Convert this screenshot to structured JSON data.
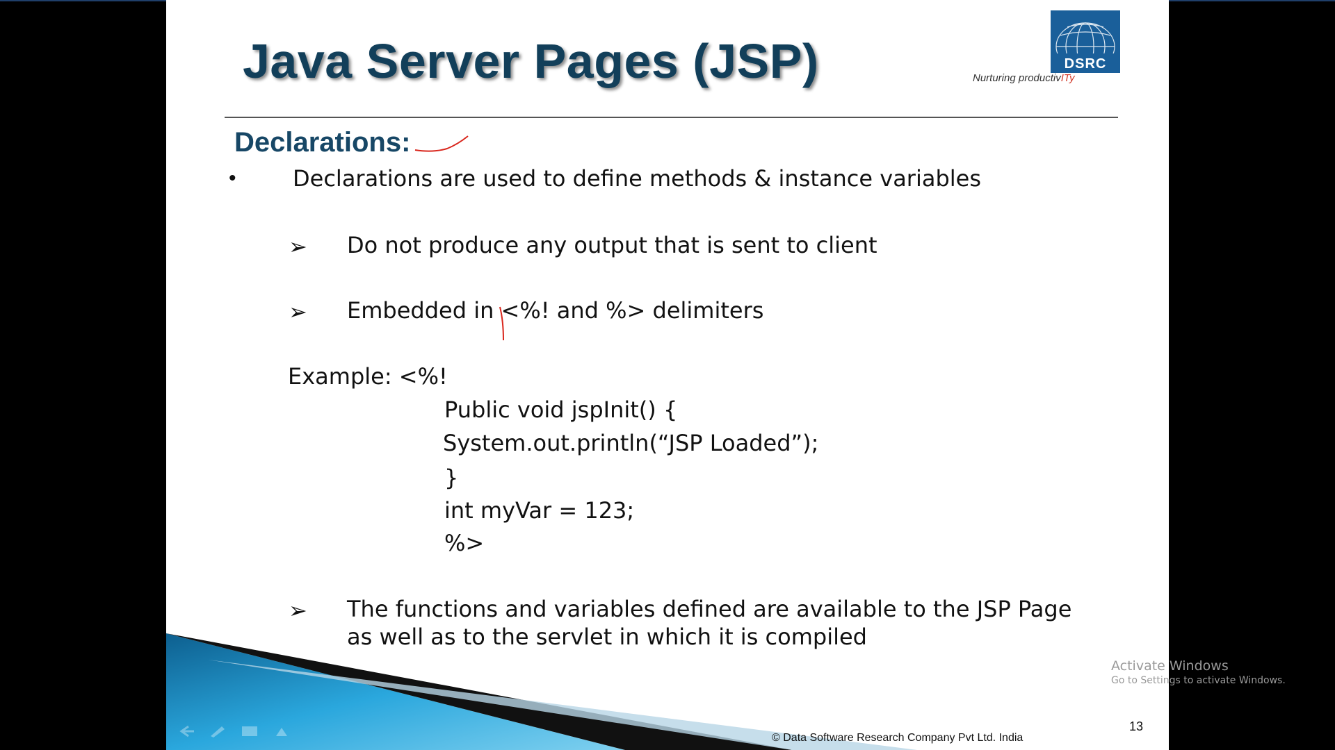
{
  "slide": {
    "title": "Java Server Pages (JSP)",
    "logo_text": "DSRC",
    "tagline_prefix": "Nurturing productiv",
    "tagline_highlight": "ITy",
    "heading": "Declarations:",
    "bullet": "Declarations are used to define methods & instance variables",
    "sub_bullets": [
      "Do not produce any output that is sent to client",
      "Embedded in <%! and %> delimiters"
    ],
    "example_label": "Example:  <%!",
    "code_lines": [
      "Public void jspInit() {",
      "System.out.println(“JSP Loaded”);",
      "}",
      "int myVar = 123;",
      "%>"
    ],
    "last_bullet_lines": [
      "The functions and variables defined are available to the JSP Page",
      "as well as to the servlet in which it is compiled"
    ],
    "page_number": "13",
    "footer": "© Data Software Research Company Pvt Ltd. India"
  },
  "overlay": {
    "activate_title": "Activate Windows",
    "activate_sub": "Go to Settings to activate Windows."
  },
  "colors": {
    "title": "#123f5a",
    "heading": "#174766",
    "ribbon": "#1e8fc4",
    "annotation": "#d9261c"
  },
  "icons": [
    "arrow-bullet-icon",
    "prev-slide-icon",
    "pen-icon",
    "slides-menu-icon",
    "more-options-icon"
  ]
}
